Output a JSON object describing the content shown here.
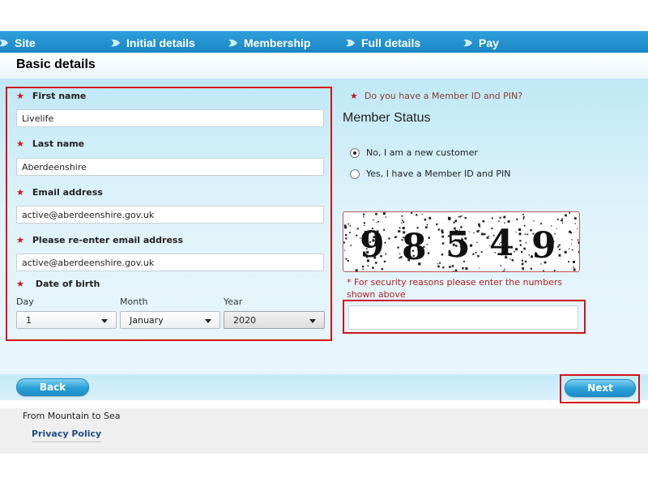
{
  "nav": {
    "steps": [
      {
        "label": "Site"
      },
      {
        "label": "Initial details"
      },
      {
        "label": "Membership"
      },
      {
        "label": "Full details"
      },
      {
        "label": "Pay"
      }
    ]
  },
  "page": {
    "title": "Basic details"
  },
  "form": {
    "first_name": {
      "label": "First name",
      "value": "Livelife"
    },
    "last_name": {
      "label": "Last name",
      "value": "Aberdeenshire"
    },
    "email": {
      "label": "Email address",
      "value": "active@aberdeenshire.gov.uk"
    },
    "email_confirm": {
      "label": "Please re-enter email address",
      "value": "active@aberdeenshire.gov.uk"
    },
    "dob": {
      "label": "Date of birth",
      "day": {
        "label": "Day",
        "value": "1"
      },
      "month": {
        "label": "Month",
        "value": "January"
      },
      "year": {
        "label": "Year",
        "value": "2020"
      }
    },
    "required_marker": "★"
  },
  "member": {
    "question": "Do you have a Member ID and PIN?",
    "heading": "Member Status",
    "options": [
      {
        "label": "No, I am a new customer",
        "checked": true
      },
      {
        "label": "Yes, I have a Member ID and PIN",
        "checked": false
      }
    ]
  },
  "captcha": {
    "digits": [
      "9",
      "8",
      "5",
      "4",
      "9"
    ],
    "note": "* For security reasons please enter the numbers shown above",
    "value": ""
  },
  "buttons": {
    "back": "Back",
    "next": "Next"
  },
  "footer": {
    "tagline": "From Mountain to Sea",
    "privacy": "Privacy Policy"
  },
  "colors": {
    "accent": "#1a86c7",
    "required": "#d0121b",
    "highlight_border": "#d0121b"
  }
}
